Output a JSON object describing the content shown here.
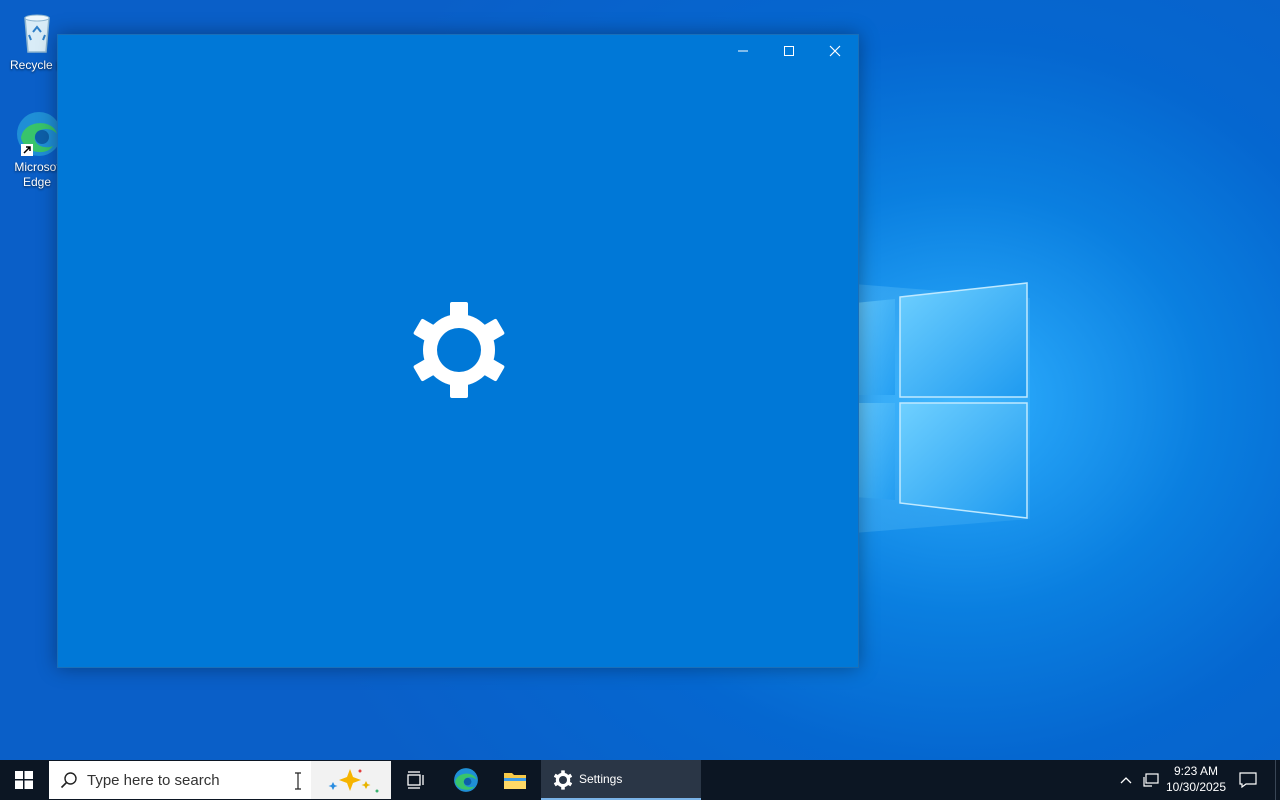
{
  "desktop": {
    "icons": [
      {
        "label": "Recycle B",
        "icon": "recycle-bin-icon"
      },
      {
        "label": "Microsoft Edge",
        "line1": "Microsof",
        "line2": "Edge",
        "icon": "edge-icon"
      }
    ]
  },
  "window": {
    "title": "Settings",
    "minimize_icon": "minimize-icon",
    "maximize_icon": "maximize-icon",
    "close_icon": "close-icon",
    "splash_icon": "gear-icon",
    "background": "#0078d7"
  },
  "taskbar": {
    "search_placeholder": "Type here to search",
    "pinned": [
      "task-view",
      "microsoft-edge",
      "file-explorer"
    ],
    "active_app_label": "Settings",
    "time": "9:23 AM",
    "date": "10/30/2025"
  },
  "colors": {
    "accent": "#0078d7",
    "taskbar": "#0c1623"
  }
}
